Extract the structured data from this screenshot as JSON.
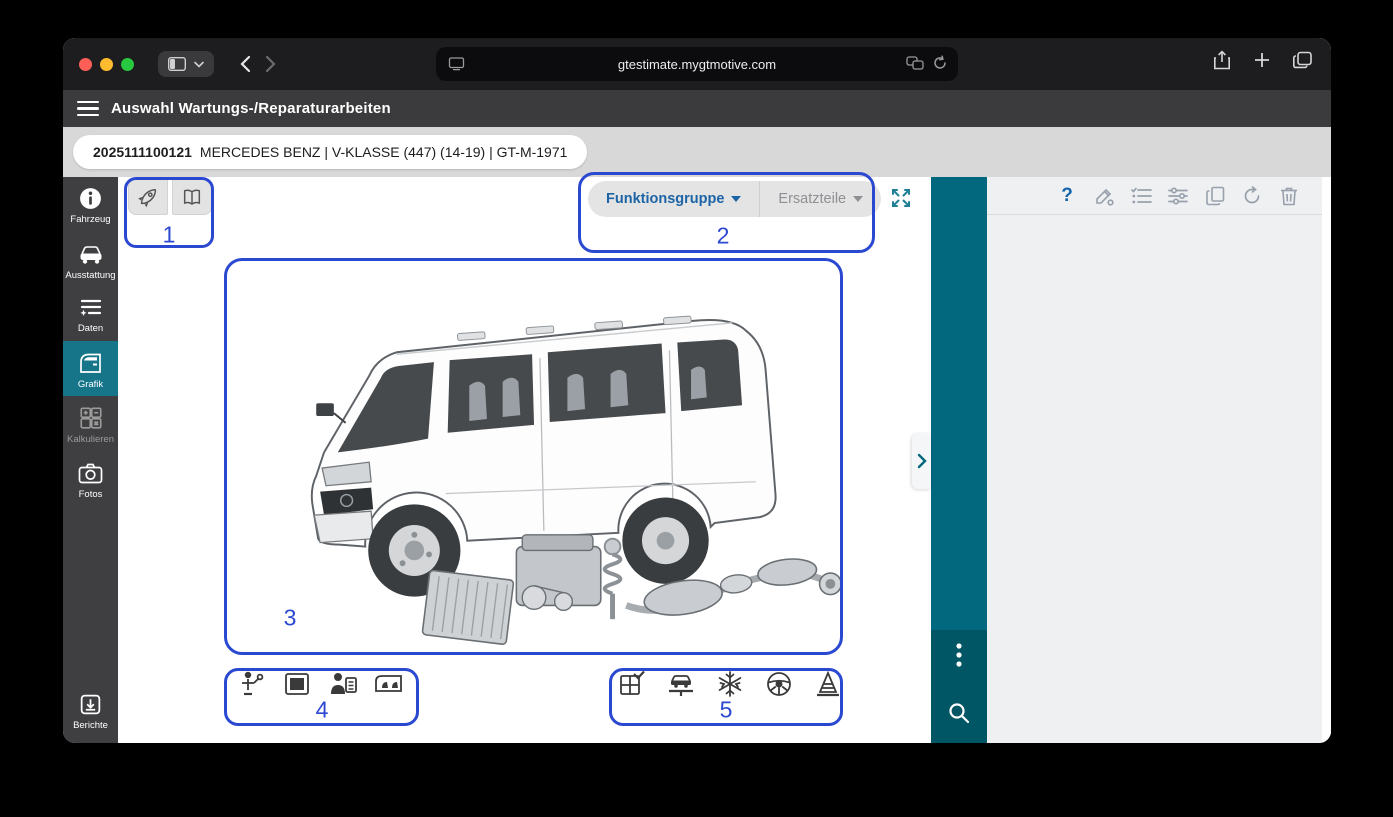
{
  "browser": {
    "url": "gtestimate.mygtmotive.com"
  },
  "app_header": {
    "title": "Auswahl Wartungs-/Reparaturarbeiten"
  },
  "vehicle_bar": {
    "case_number": "2025111100121",
    "vehicle_info": "MERCEDES BENZ | V-KLASSE (447) (14-19) | GT-M-1971"
  },
  "sidebar": {
    "items": [
      {
        "label": "Fahrzeug",
        "icon": "info-icon",
        "active": false
      },
      {
        "label": "Ausstattung",
        "icon": "car-icon",
        "active": false
      },
      {
        "label": "Daten",
        "icon": "data-list-icon",
        "active": false
      },
      {
        "label": "Grafik",
        "icon": "car-door-icon",
        "active": true
      },
      {
        "label": "Kalkulieren",
        "icon": "calculator-icon",
        "disabled": true
      },
      {
        "label": "Fotos",
        "icon": "camera-icon",
        "active": false
      },
      {
        "label": "Berichte",
        "icon": "report-download-icon",
        "active": false
      }
    ]
  },
  "graphics_view": {
    "toolbar_buttons": [
      {
        "icon": "rocket-icon"
      },
      {
        "icon": "catalog-icon"
      }
    ],
    "group_tabs": {
      "funktionsgruppe": "Funktionsgruppe",
      "ersatzteile": "Ersatzteile"
    },
    "bottom_left_icons": [
      "service-icon",
      "panel-frame-icon",
      "inspection-icon",
      "interior-icon"
    ],
    "bottom_right_icons": [
      "maintenance-grid-icon",
      "car-lift-icon",
      "climate-icon",
      "steering-wheel-icon",
      "jack-icon"
    ]
  },
  "right_panel": {
    "help_glyph": "?"
  },
  "annotations": {
    "color": "#2b49d0",
    "labels": [
      "1",
      "2",
      "3",
      "4",
      "5"
    ]
  }
}
